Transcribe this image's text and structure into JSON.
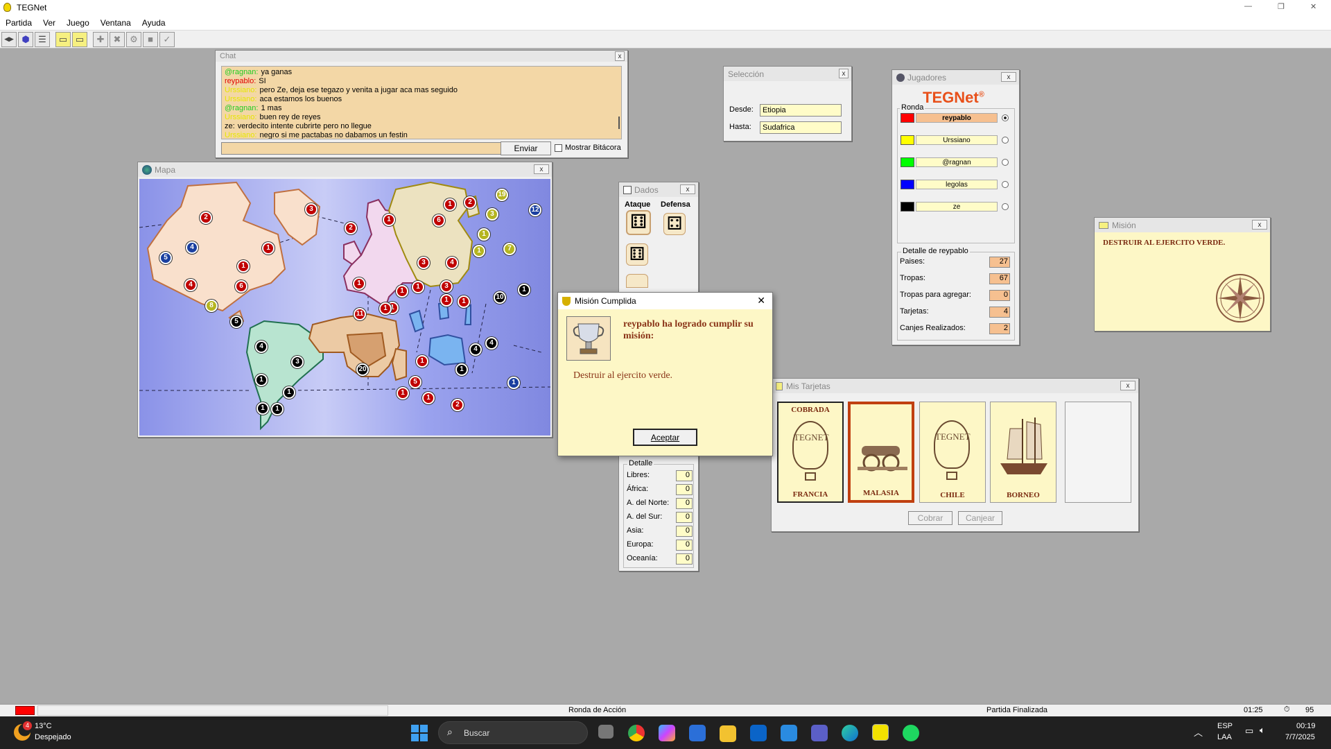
{
  "app": {
    "title": "TEGNet",
    "window_controls": [
      "—",
      "❐",
      "✕"
    ]
  },
  "menu": [
    "Partida",
    "Ver",
    "Juego",
    "Ventana",
    "Ayuda"
  ],
  "toolbar": [
    "◀▶",
    "⬢",
    "☰",
    "▭",
    "▭",
    "✚",
    "✖",
    "⚙",
    "■",
    "✓"
  ],
  "chat": {
    "title": "Chat",
    "messages": [
      {
        "user": "@ragnan:",
        "text": "ya ganas",
        "color": "#22cc22"
      },
      {
        "user": "reypablo:",
        "text": "SI",
        "color": "#e00000"
      },
      {
        "user": "Urssiano:",
        "text": "pero Ze, deja ese tegazo y venita a jugar aca mas seguido",
        "color": "#e6e600"
      },
      {
        "user": "Urssiano:",
        "text": "aca estamos los buenos",
        "color": "#e6e600"
      },
      {
        "user": "@ragnan:",
        "text": "1 mas",
        "color": "#22cc22"
      },
      {
        "user": "Urssiano:",
        "text": "buen rey de reyes",
        "color": "#e6e600"
      },
      {
        "user": "ze:",
        "text": "verdecito intente cubrirte pero no llegue",
        "color": "#000000"
      },
      {
        "user": "Urssiano:",
        "text": "negro si me pactabas no dabamos un festin",
        "color": "#e6e600"
      }
    ],
    "send": "Enviar",
    "log": "Mostrar Bitácora"
  },
  "seleccion": {
    "title": "Selección",
    "desde_label": "Desde:",
    "desde": "Etiopia",
    "hasta_label": "Hasta:",
    "hasta": "Sudafrica"
  },
  "jugadores": {
    "title": "Jugadores",
    "logo": "TEGNet",
    "logo_mark": "®",
    "round_label": "Ronda",
    "players": [
      {
        "name": "reypablo",
        "color": "#ff0000"
      },
      {
        "name": "Urssiano",
        "color": "#ffff00"
      },
      {
        "name": "@ragnan",
        "color": "#00ff00"
      },
      {
        "name": "legolas",
        "color": "#0000ff"
      },
      {
        "name": "ze",
        "color": "#000000"
      }
    ],
    "detail_title": "Detalle de reypablo",
    "stats": [
      {
        "label": "Paises:",
        "value": "27"
      },
      {
        "label": "Tropas:",
        "value": "67"
      },
      {
        "label": "Tropas para agregar:",
        "value": "0"
      },
      {
        "label": "Tarjetas:",
        "value": "4"
      },
      {
        "label": "Canjes Realizados:",
        "value": "2"
      }
    ]
  },
  "mision": {
    "title": "Misión",
    "text": "DESTRUIR AL EJERCITO VERDE."
  },
  "mapa": {
    "title": "Mapa",
    "armies": [
      {
        "n": "2",
        "c": "#c00000"
      },
      {
        "n": "3",
        "c": "#c00000"
      },
      {
        "n": "4",
        "c": "#1a3fa0"
      },
      {
        "n": "5",
        "c": "#1a3fa0"
      },
      {
        "n": "1",
        "c": "#c00000"
      },
      {
        "n": "1",
        "c": "#c00000"
      },
      {
        "n": "4",
        "c": "#c00000"
      },
      {
        "n": "6",
        "c": "#c00000"
      },
      {
        "n": "8",
        "c": "#b5b520"
      },
      {
        "n": "5",
        "c": "#000000"
      },
      {
        "n": "4",
        "c": "#000000"
      },
      {
        "n": "3",
        "c": "#000000"
      },
      {
        "n": "1",
        "c": "#000000"
      },
      {
        "n": "1",
        "c": "#000000"
      },
      {
        "n": "1",
        "c": "#000000"
      },
      {
        "n": "1",
        "c": "#000000"
      },
      {
        "n": "2",
        "c": "#c00000"
      },
      {
        "n": "1",
        "c": "#c00000"
      },
      {
        "n": "3",
        "c": "#c00000"
      },
      {
        "n": "1",
        "c": "#c00000"
      },
      {
        "n": "1",
        "c": "#c00000"
      },
      {
        "n": "1",
        "c": "#c00000"
      },
      {
        "n": "1",
        "c": "#c00000"
      },
      {
        "n": "11",
        "c": "#c00000"
      },
      {
        "n": "1",
        "c": "#c00000"
      },
      {
        "n": "1",
        "c": "#c00000"
      },
      {
        "n": "2",
        "c": "#c00000"
      },
      {
        "n": "6",
        "c": "#c00000"
      },
      {
        "n": "19",
        "c": "#b5b520"
      },
      {
        "n": "3",
        "c": "#b5b520"
      },
      {
        "n": "1",
        "c": "#b5b520"
      },
      {
        "n": "7",
        "c": "#b5b520"
      },
      {
        "n": "1",
        "c": "#b5b520"
      },
      {
        "n": "4",
        "c": "#c00000"
      },
      {
        "n": "12",
        "c": "#1a3fa0"
      },
      {
        "n": "3",
        "c": "#c00000"
      },
      {
        "n": "1",
        "c": "#c00000"
      },
      {
        "n": "1",
        "c": "#c00000"
      },
      {
        "n": "10",
        "c": "#000000"
      },
      {
        "n": "1",
        "c": "#000000"
      },
      {
        "n": "20",
        "c": "#000000"
      },
      {
        "n": "1",
        "c": "#c00000"
      },
      {
        "n": "5",
        "c": "#c00000"
      },
      {
        "n": "1",
        "c": "#c00000"
      },
      {
        "n": "1",
        "c": "#c00000"
      },
      {
        "n": "2",
        "c": "#c00000"
      },
      {
        "n": "4",
        "c": "#000000"
      },
      {
        "n": "4",
        "c": "#000000"
      },
      {
        "n": "1",
        "c": "#000000"
      },
      {
        "n": "1",
        "c": "#1a3fa0"
      }
    ]
  },
  "dados": {
    "title": "Dados",
    "ataque": "Ataque",
    "defensa": "Defensa",
    "detalle": "Detalle",
    "rows": [
      {
        "label": "Libres:",
        "value": "0"
      },
      {
        "label": "África:",
        "value": "0"
      },
      {
        "label": "A. del Norte:",
        "value": "0"
      },
      {
        "label": "A. del Sur:",
        "value": "0"
      },
      {
        "label": "Asia:",
        "value": "0"
      },
      {
        "label": "Europa:",
        "value": "0"
      },
      {
        "label": "Oceanía:",
        "value": "0"
      }
    ]
  },
  "dialog": {
    "title": "Misión Cumplida",
    "headline": "reypablo ha logrado cumplir su misión:",
    "body": "Destruir al ejercito verde.",
    "ok": "Aceptar"
  },
  "tarjetas": {
    "title": "Mis Tarjetas",
    "cards": [
      {
        "name": "FRANCIA",
        "badge": "COBRADA",
        "art": "TEGNET"
      },
      {
        "name": "MALASIA",
        "badge": "",
        "art": "cannon"
      },
      {
        "name": "CHILE",
        "badge": "",
        "art": "TEGNET"
      },
      {
        "name": "BORNEO",
        "badge": "",
        "art": "ship"
      }
    ],
    "cobrar": "Cobrar",
    "canjear": "Canjear"
  },
  "status": {
    "phase": "Ronda de Acción",
    "state": "Partida Finalizada",
    "time": "01:25",
    "count": "95"
  },
  "taskbar": {
    "temp": "13°C",
    "weather": "Despejado",
    "search": "Buscar",
    "lang": "ESP",
    "lang2": "LAA",
    "clock": "00:19",
    "date": "7/7/2025",
    "weather_badge": "4"
  }
}
